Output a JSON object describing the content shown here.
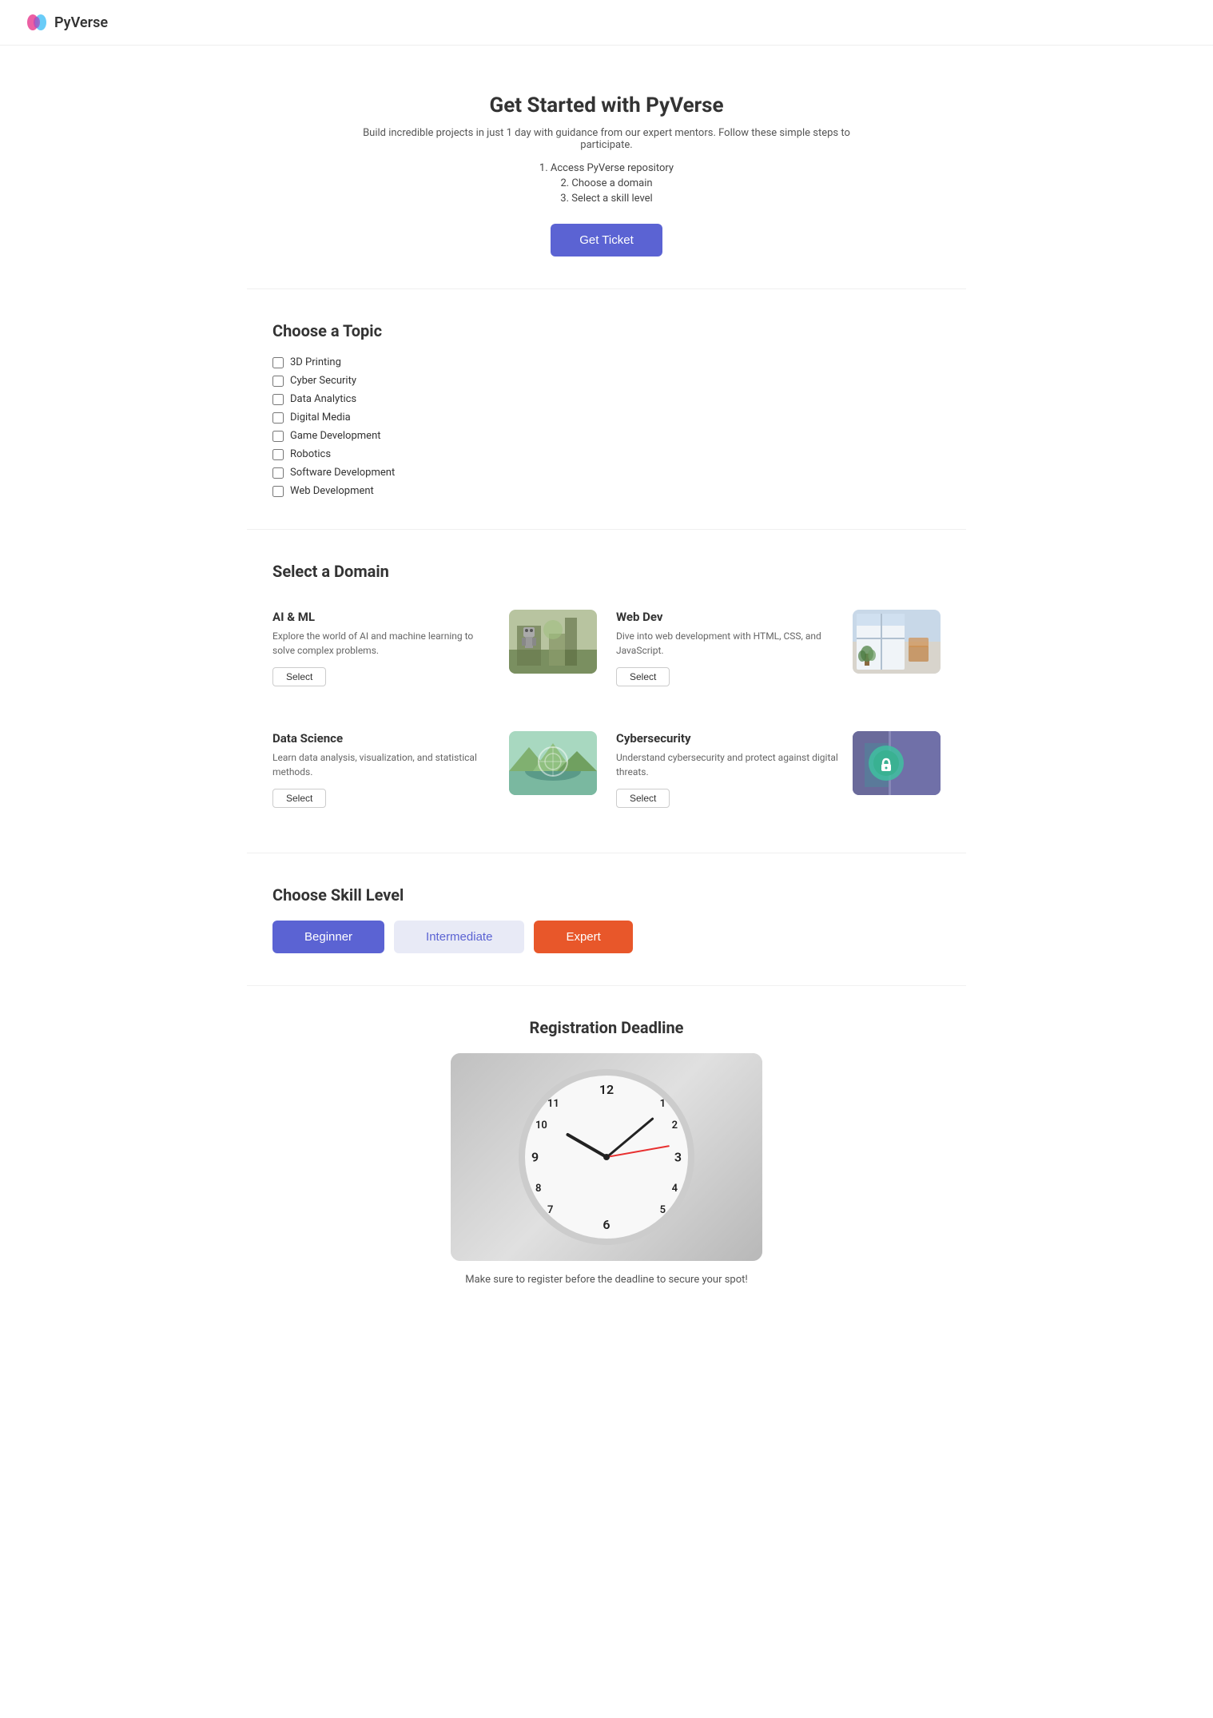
{
  "brand": {
    "name": "PyVerse"
  },
  "hero": {
    "title": "Get Started with PyVerse",
    "description": "Build incredible projects in just 1 day with guidance from our expert mentors. Follow these simple steps to participate.",
    "steps": [
      "1. Access PyVerse repository",
      "2. Choose a domain",
      "3. Select a skill level"
    ],
    "cta_label": "Get Ticket"
  },
  "topics": {
    "heading": "Choose a Topic",
    "items": [
      "3D Printing",
      "Cyber Security",
      "Data Analytics",
      "Digital Media",
      "Game Development",
      "Robotics",
      "Software Development",
      "Web Development"
    ]
  },
  "domains": {
    "heading": "Select a Domain",
    "items": [
      {
        "id": "ai-ml",
        "title": "AI & ML",
        "description": "Explore the world of AI and machine learning to solve complex problems.",
        "select_label": "Select",
        "image_color1": "#8B9E6A",
        "image_color2": "#5a7a4a"
      },
      {
        "id": "web-dev",
        "title": "Web Dev",
        "description": "Dive into web development with HTML, CSS, and JavaScript.",
        "select_label": "Select",
        "image_color1": "#a0b8c8",
        "image_color2": "#7090a0"
      },
      {
        "id": "data-science",
        "title": "Data Science",
        "description": "Learn data analysis, visualization, and statistical methods.",
        "select_label": "Select",
        "image_color1": "#6ab8a0",
        "image_color2": "#3a8870"
      },
      {
        "id": "cybersecurity",
        "title": "Cybersecurity",
        "description": "Understand cybersecurity and protect against digital threats.",
        "select_label": "Select",
        "image_color1": "#8888cc",
        "image_color2": "#5555aa"
      }
    ]
  },
  "skill_level": {
    "heading": "Choose Skill Level",
    "options": [
      {
        "id": "beginner",
        "label": "Beginner",
        "class": "beginner"
      },
      {
        "id": "intermediate",
        "label": "Intermediate",
        "class": "intermediate"
      },
      {
        "id": "expert",
        "label": "Expert",
        "class": "expert"
      }
    ]
  },
  "deadline": {
    "heading": "Registration Deadline",
    "note": "Make sure to register before the deadline to secure your spot!"
  }
}
